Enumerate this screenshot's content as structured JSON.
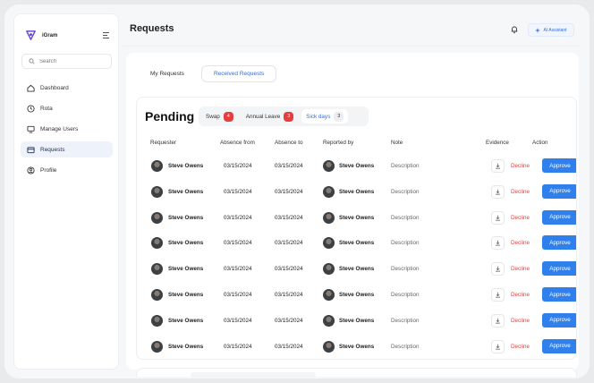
{
  "app": {
    "name": "iGram"
  },
  "sidebar": {
    "search_placeholder": "Search",
    "items": [
      {
        "label": "Dashboard",
        "icon": "home-icon"
      },
      {
        "label": "Rota",
        "icon": "clock-icon"
      },
      {
        "label": "Manage Users",
        "icon": "users-icon"
      },
      {
        "label": "Requests",
        "icon": "inbox-icon",
        "active": true
      },
      {
        "label": "Profile",
        "icon": "user-icon"
      }
    ]
  },
  "header": {
    "title": "Requests",
    "ai_button": "AI Assistant"
  },
  "tabs": [
    {
      "label": "My Requests",
      "active": false
    },
    {
      "label": "Received Requests",
      "active": true
    }
  ],
  "pending": {
    "title": "Pending",
    "filters": [
      {
        "label": "Swap",
        "count": "4"
      },
      {
        "label": "Annual Leave",
        "count": "3"
      },
      {
        "label": "Sick days",
        "count": "3",
        "active": true
      }
    ],
    "columns": [
      "Requester",
      "Absence from",
      "Absence to",
      "Reported by",
      "Note",
      "Evidence",
      "Action"
    ],
    "rows": [
      {
        "requester": "Steve Owens",
        "from": "03/15/2024",
        "to": "03/15/2024",
        "reported_by": "Steve Owens",
        "note": "Description",
        "decline": "Decline",
        "approve": "Approve"
      },
      {
        "requester": "Steve Owens",
        "from": "03/15/2024",
        "to": "03/15/2024",
        "reported_by": "Steve Owens",
        "note": "Description",
        "decline": "Decline",
        "approve": "Approve"
      },
      {
        "requester": "Steve Owens",
        "from": "03/15/2024",
        "to": "03/15/2024",
        "reported_by": "Steve Owens",
        "note": "Description",
        "decline": "Decline",
        "approve": "Approve"
      },
      {
        "requester": "Steve Owens",
        "from": "03/15/2024",
        "to": "03/15/2024",
        "reported_by": "Steve Owens",
        "note": "Description",
        "decline": "Decline",
        "approve": "Approve"
      },
      {
        "requester": "Steve Owens",
        "from": "03/15/2024",
        "to": "03/15/2024",
        "reported_by": "Steve Owens",
        "note": "Description",
        "decline": "Decline",
        "approve": "Approve"
      },
      {
        "requester": "Steve Owens",
        "from": "03/15/2024",
        "to": "03/15/2024",
        "reported_by": "Steve Owens",
        "note": "Description",
        "decline": "Decline",
        "approve": "Approve"
      },
      {
        "requester": "Steve Owens",
        "from": "03/15/2024",
        "to": "03/15/2024",
        "reported_by": "Steve Owens",
        "note": "Description",
        "decline": "Decline",
        "approve": "Approve"
      },
      {
        "requester": "Steve Owens",
        "from": "03/15/2024",
        "to": "03/15/2024",
        "reported_by": "Steve Owens",
        "note": "Description",
        "decline": "Decline",
        "approve": "Approve"
      }
    ]
  },
  "colors": {
    "accent": "#2f80ed",
    "danger": "#e53e3e",
    "brand": "#6c4ad8"
  }
}
